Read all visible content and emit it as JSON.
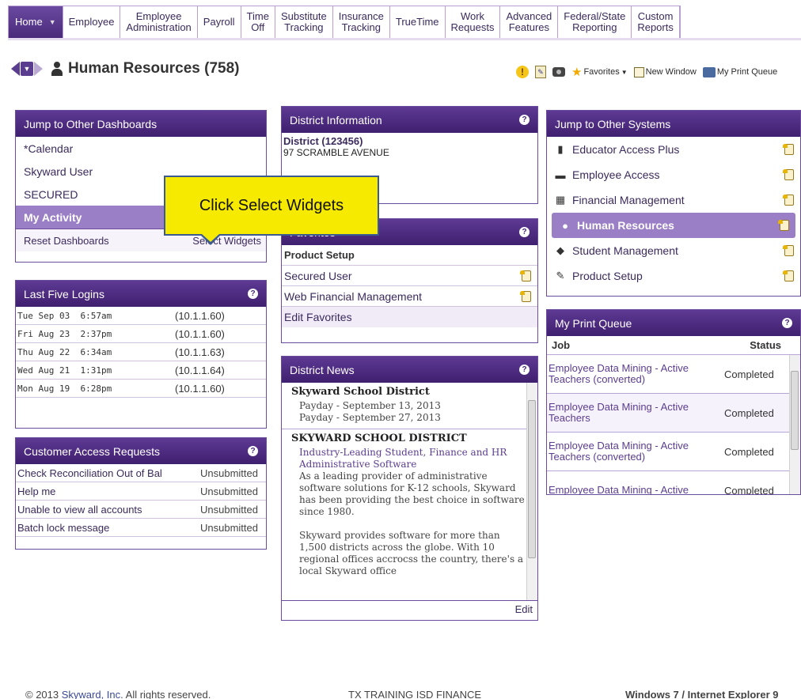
{
  "nav": {
    "items": [
      {
        "label": "Home"
      },
      {
        "label": "Employee"
      },
      {
        "label": "Employee\nAdministration"
      },
      {
        "label": "Payroll"
      },
      {
        "label": "Time\nOff"
      },
      {
        "label": "Substitute\nTracking"
      },
      {
        "label": "Insurance\nTracking"
      },
      {
        "label": "TrueTime"
      },
      {
        "label": "Work\nRequests"
      },
      {
        "label": "Advanced\nFeatures"
      },
      {
        "label": "Federal/State\nReporting"
      },
      {
        "label": "Custom\nReports"
      }
    ]
  },
  "page": {
    "title": "Human Resources (758)"
  },
  "utils": {
    "favorites": "Favorites",
    "new_window": "New Window",
    "print_queue": "My Print Queue"
  },
  "jump_dashboards": {
    "title": "Jump to Other Dashboards",
    "items": [
      "*Calendar",
      "Skyward User",
      "SECURED",
      "My Activity"
    ],
    "reset": "Reset Dashboards",
    "select_widgets": "Select Widgets"
  },
  "callout": {
    "text": "Click Select Widgets"
  },
  "last_logins": {
    "title": "Last Five Logins",
    "rows": [
      {
        "time": "Tue Sep 03  6:57am",
        "ip": "(10.1.1.60)"
      },
      {
        "time": "Fri Aug 23  2:37pm",
        "ip": "(10.1.1.60)"
      },
      {
        "time": "Thu Aug 22  6:34am",
        "ip": "(10.1.1.63)"
      },
      {
        "time": "Wed Aug 21  1:31pm",
        "ip": "(10.1.1.64)"
      },
      {
        "time": "Mon Aug 19  6:28pm",
        "ip": "(10.1.1.60)"
      }
    ]
  },
  "access_requests": {
    "title": "Customer Access Requests",
    "rows": [
      {
        "name": "Check Reconciliation Out of Bal",
        "status": "Unsubmitted"
      },
      {
        "name": "Help me",
        "status": "Unsubmitted"
      },
      {
        "name": "Unable to view all accounts",
        "status": "Unsubmitted"
      },
      {
        "name": "Batch lock message",
        "status": "Unsubmitted"
      }
    ]
  },
  "district_info": {
    "title": "District Information",
    "name": "District (123456)",
    "address": "97 SCRAMBLE AVENUE"
  },
  "favorites": {
    "title": "Favorites",
    "heading": "Product Setup",
    "items": [
      "Secured User",
      "Web Financial Management"
    ],
    "edit": "Edit Favorites"
  },
  "news": {
    "title": "District News",
    "block1": {
      "heading": "Skyward School District",
      "line1": "Payday - September 13, 2013",
      "line2": "Payday - September 27, 2013"
    },
    "block2": {
      "heading": "SKYWARD SCHOOL DISTRICT",
      "highlight": "Industry-Leading Student, Finance and HR Administrative Software",
      "para1": "As a leading provider of administrative software solutions for K-12 schools, Skyward has been providing the best choice in software since 1980.",
      "para2": "Skyward provides software for more than 1,500 districts across the globe. With 10 regional offices accrocss the country, there's a local Skyward office"
    },
    "edit": "Edit"
  },
  "systems": {
    "title": "Jump to Other Systems",
    "items": [
      {
        "label": "Educator Access Plus",
        "icon": "mobile-icon"
      },
      {
        "label": "Employee Access",
        "icon": "briefcase-icon"
      },
      {
        "label": "Financial Management",
        "icon": "calculator-icon"
      },
      {
        "label": "Human Resources",
        "icon": "person-icon"
      },
      {
        "label": "Student Management",
        "icon": "graduation-cap-icon"
      },
      {
        "label": "Product Setup",
        "icon": "wrench-icon"
      }
    ]
  },
  "print_queue": {
    "title": "My Print Queue",
    "col_job": "Job",
    "col_status": "Status",
    "rows": [
      {
        "job": "Employee Data Mining - Active Teachers (converted)",
        "status": "Completed"
      },
      {
        "job": "Employee Data Mining - Active Teachers",
        "status": "Completed"
      },
      {
        "job": "Employee Data Mining - Active Teachers (converted)",
        "status": "Completed"
      },
      {
        "job": "Employee Data Mining - Active",
        "status": "Completed"
      }
    ]
  },
  "footer": {
    "copyright_prefix": "© 2013 ",
    "company": "Skyward, Inc.",
    "copyright_suffix": " All rights reserved.",
    "center": "TX TRAINING ISD FINANCE",
    "right": "Windows 7 / Internet Explorer 9"
  }
}
